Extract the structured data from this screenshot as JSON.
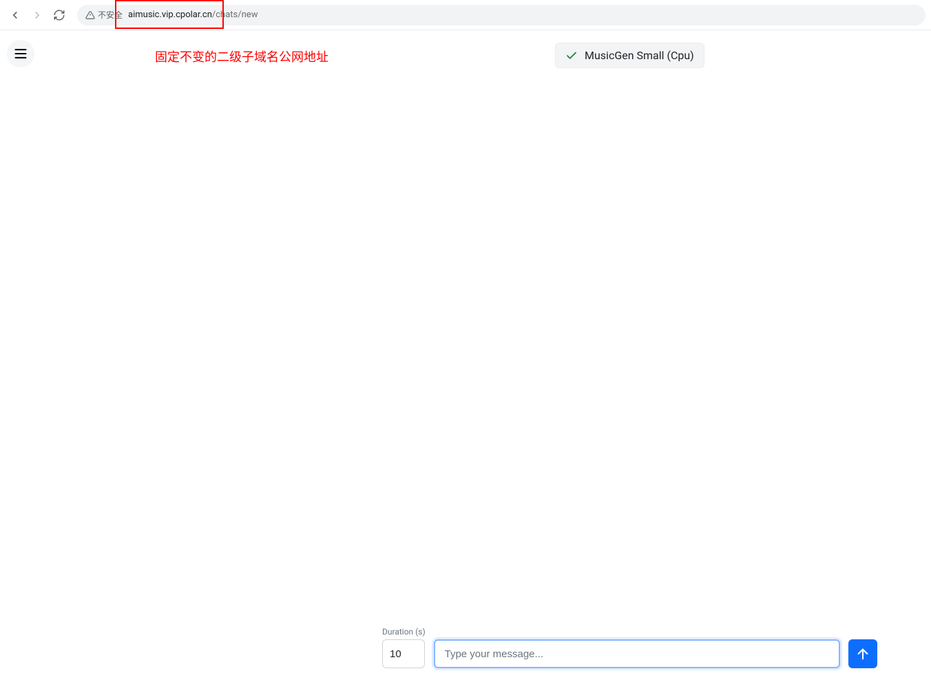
{
  "browser": {
    "not_secure_label": "不安全",
    "url_domain": "aimusic.vip.cpolar.cn",
    "url_path": "/chats/new"
  },
  "annotation": {
    "text": "固定不变的二级子域名公网地址"
  },
  "model_badge": {
    "label": "MusicGen Small (Cpu)"
  },
  "input_area": {
    "duration_label": "Duration (s)",
    "duration_value": "10",
    "message_placeholder": "Type your message..."
  }
}
